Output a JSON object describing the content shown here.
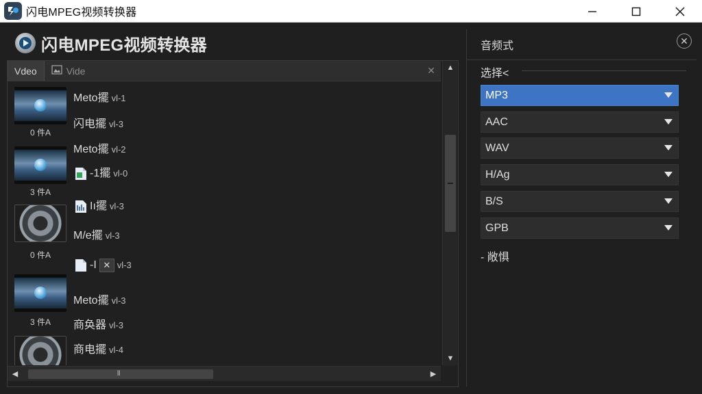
{
  "window": {
    "title": "闪电MPEG视频转换器",
    "controls": {
      "minimize": "—",
      "maximize": "☐",
      "close": "✕"
    }
  },
  "app": {
    "title": "闪电MPEG视频转换器"
  },
  "file_panel": {
    "tabs": [
      {
        "label": "Vdeo",
        "icon": "video-tab-icon"
      },
      {
        "label": "Vide",
        "icon": "image-tab-icon"
      }
    ],
    "tab_close": "✕",
    "thumb_captions": [
      "0 件A",
      "3 件A",
      "0 件A",
      "3 件A"
    ],
    "rows": [
      {
        "name": "Meto擺",
        "meta": "vl-1"
      },
      {
        "name": "闪电擺",
        "meta": "vl-3"
      },
      {
        "name": "Meto擺",
        "meta": "vl-2"
      },
      {
        "name": "-1擺",
        "meta": "vl-0"
      },
      {
        "name": "Iı擺",
        "meta": "vl-3"
      },
      {
        "name": "M/e擺",
        "meta": "vl-3"
      },
      {
        "name": "-I",
        "meta": "vl-3",
        "chip": "✕"
      },
      {
        "name": "Meto擺",
        "meta": "vl-3"
      },
      {
        "name": "商奂器",
        "meta": "vl-3"
      },
      {
        "name": "商电擺",
        "meta": "vl-4"
      }
    ],
    "scroll": {
      "up": "▲",
      "down": "▼",
      "left": "◀",
      "right": "▶",
      "grip": "⫴",
      "vertical_position": 0.4
    }
  },
  "settings": {
    "title": "音频式",
    "close": "✕",
    "select_label": "选择<",
    "formats": [
      {
        "label": "MP3",
        "selected": true
      },
      {
        "label": "AAC",
        "selected": false
      },
      {
        "label": "WAV",
        "selected": false
      },
      {
        "label": "H/Ag",
        "selected": false
      },
      {
        "label": "B/S",
        "selected": false
      },
      {
        "label": "GPB",
        "selected": false
      }
    ],
    "more": "- 敞惧"
  },
  "colors": {
    "accent": "#3d74c4",
    "background": "#1f1f1f",
    "text": "#dcdcdc"
  }
}
